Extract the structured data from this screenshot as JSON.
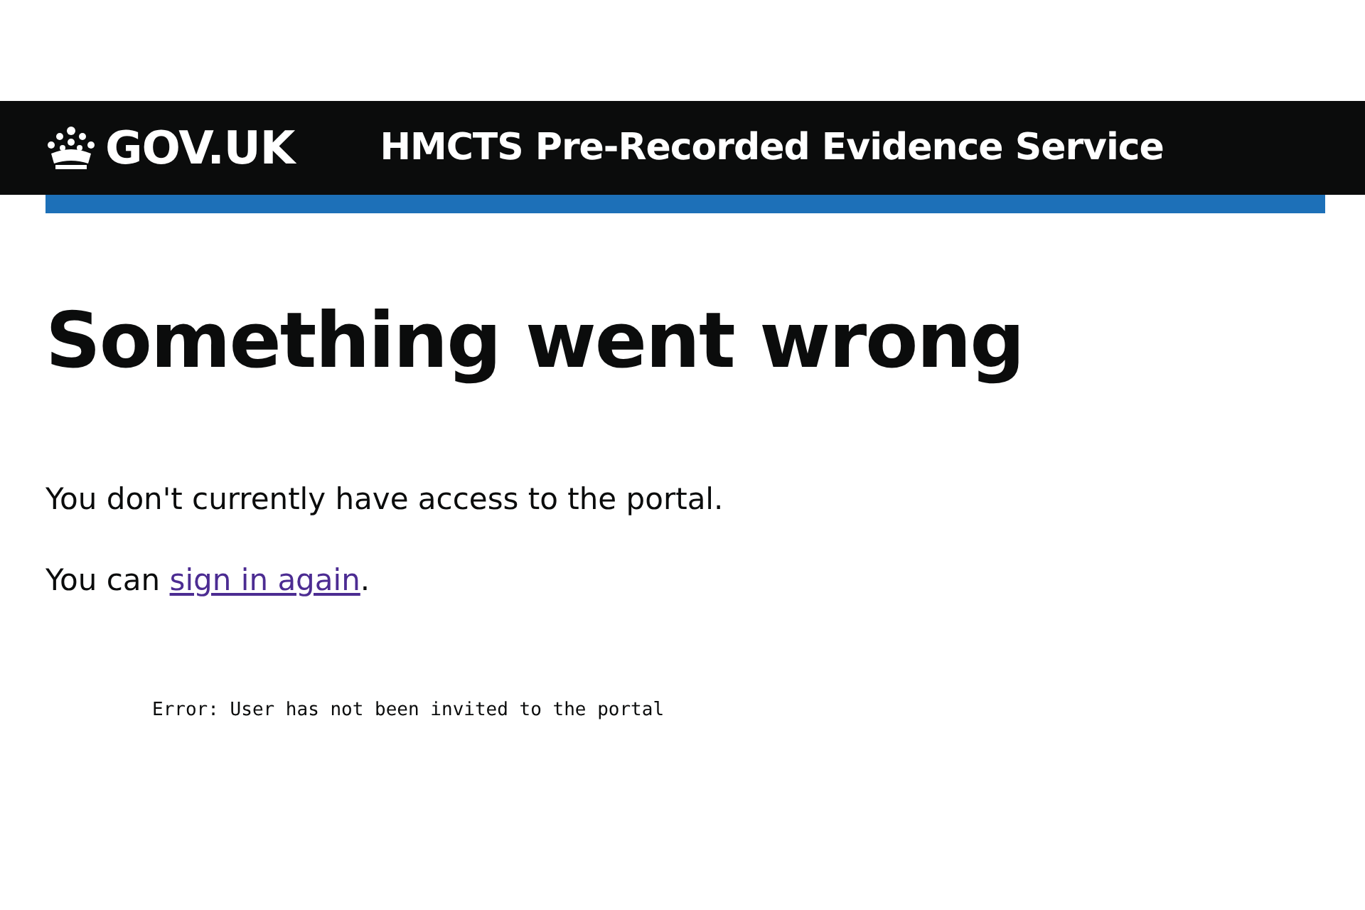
{
  "header": {
    "logo": "GOV.UK",
    "service_name": "HMCTS Pre-Recorded Evidence Service"
  },
  "heading": "Something went wrong",
  "message": "You don't currently have access to the portal.",
  "sign_in": {
    "prefix": "You can ",
    "link": "sign in again",
    "suffix": "."
  },
  "error": "Error: User has not been invited to the portal"
}
